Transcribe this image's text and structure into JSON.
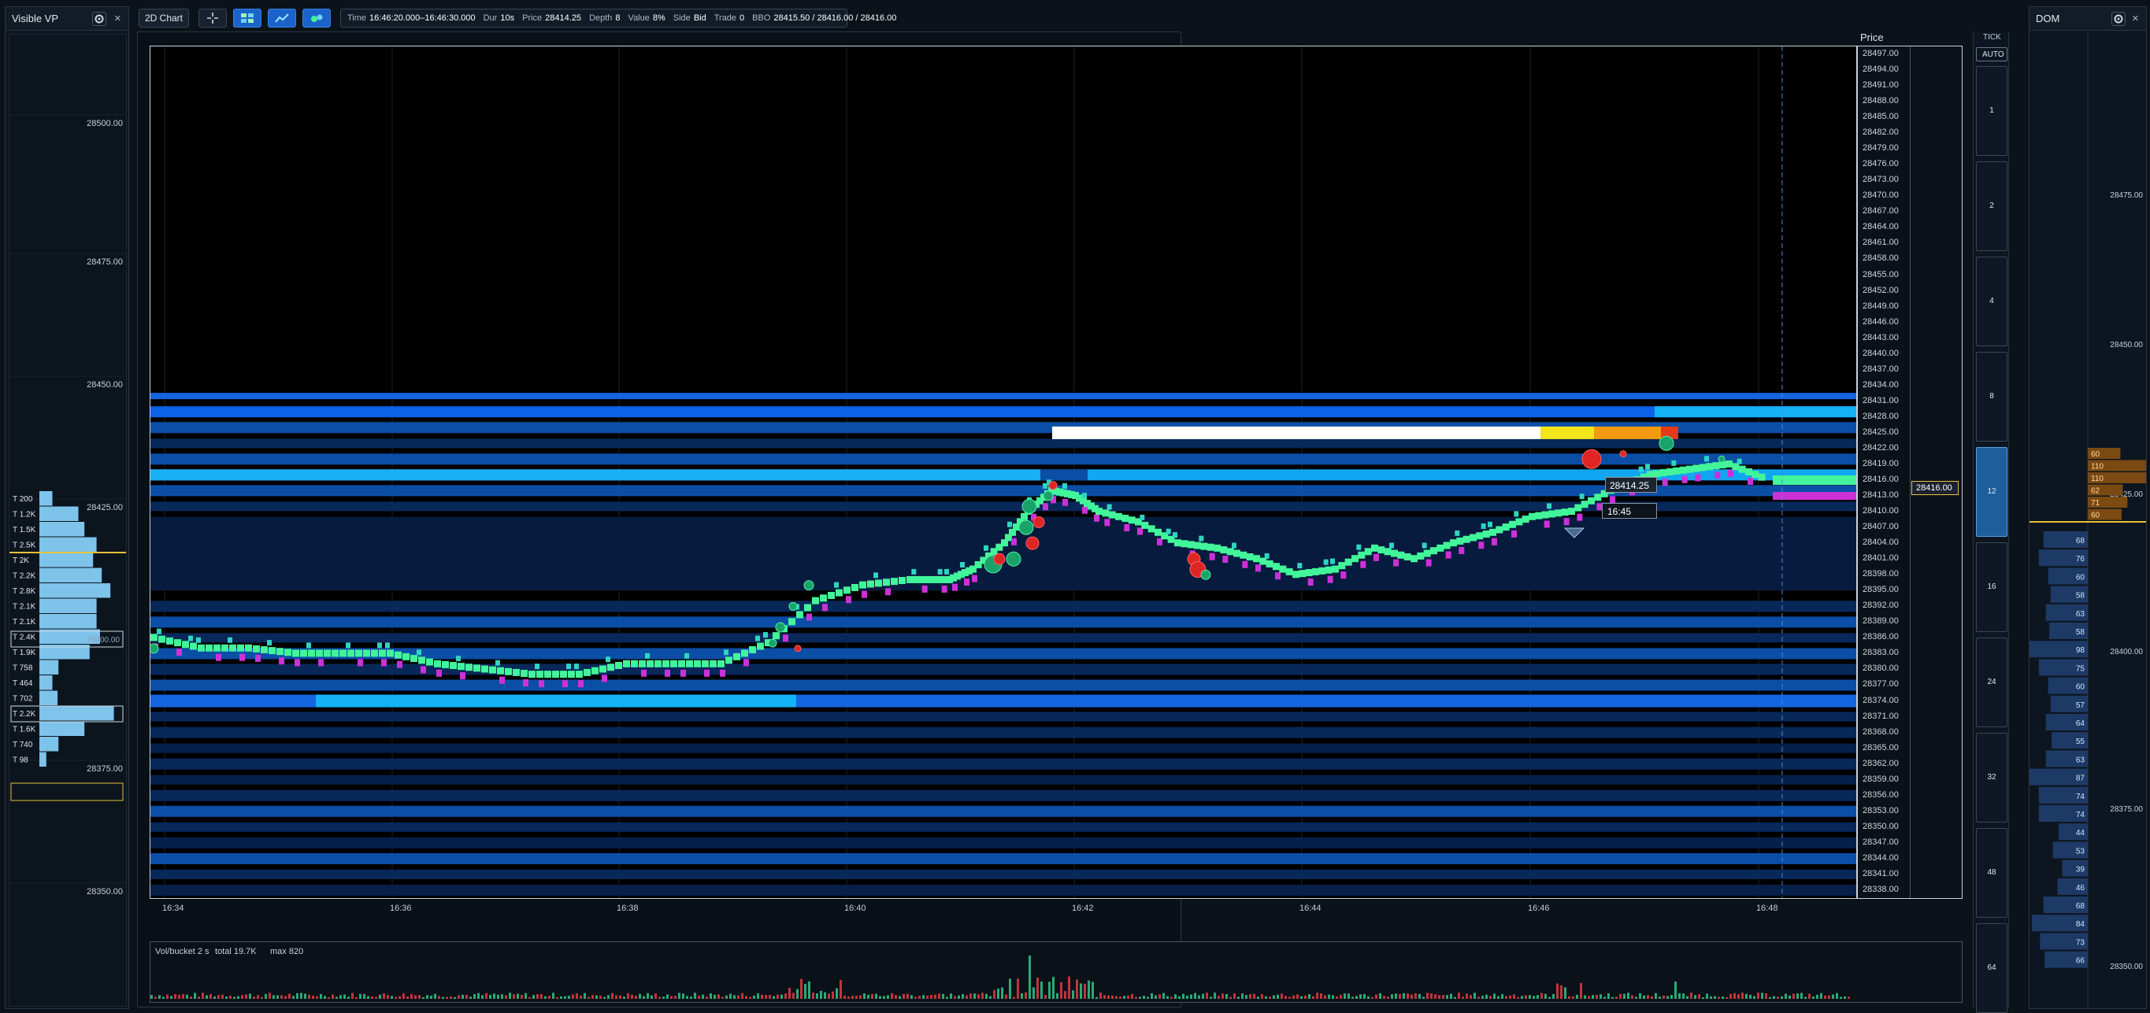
{
  "colors": {
    "bg": "#0b1219",
    "panel": "#0d1620",
    "heat_dark": "#08285a",
    "heat_mid": "#0b4ea6",
    "heat_bright": "#1565e0",
    "heat_cyan": "#11a6f2",
    "buy": "#43f59a",
    "sell": "#cc31d8",
    "buy_circle": "#19a36a",
    "sell_circle": "#e02525",
    "profile": "#7ec3ea",
    "dom_bid": "#1d3a66",
    "dom_ask": "#7a4a12",
    "highlight": "#e8c23a"
  },
  "vp": {
    "title": "Visible VP",
    "gear_icon": "gear-icon",
    "close": "×",
    "prices": [
      "28500.00",
      "28475.00",
      "28450.00",
      "28425.00",
      "28375.00",
      "28350.00"
    ],
    "rows": [
      {
        "label": "T 200",
        "v": 0.15
      },
      {
        "label": "T 1.2K",
        "v": 0.45
      },
      {
        "label": "T 1.5K",
        "v": 0.52
      },
      {
        "label": "T 2.5K",
        "v": 0.66
      },
      {
        "label": "T 2K",
        "v": 0.62
      },
      {
        "label": "T 2.2K",
        "v": 0.72
      },
      {
        "label": "T 2.8K",
        "v": 0.82
      },
      {
        "label": "T 2.1K",
        "v": 0.66
      },
      {
        "label": "T 2.1K",
        "v": 0.66
      },
      {
        "label": "T 2.4K",
        "v": 0.7
      },
      {
        "label": "T 1.9K",
        "v": 0.58
      },
      {
        "label": "T 758",
        "v": 0.22
      },
      {
        "label": "T 464",
        "v": 0.15
      },
      {
        "label": "T 702",
        "v": 0.21
      },
      {
        "label": "T 2.2K",
        "v": 0.86
      },
      {
        "label": "T 1.6K",
        "v": 0.52
      },
      {
        "label": "T 740",
        "v": 0.22
      },
      {
        "label": "T 98",
        "v": 0.08
      }
    ],
    "hidden_label": "28400.00"
  },
  "toolbar": {
    "chart_mode": "2D Chart",
    "crosshair_icon": "crosshair-icon",
    "heatmap_icon": "heatmap-icon",
    "line_icon": "line-chart-icon",
    "bubbles_icon": "bubbles-icon"
  },
  "info": {
    "time_label": "Time",
    "time": "16:46:20.000–16:46:30.000",
    "dur_label": "Dur",
    "dur": "10s",
    "price_label": "Price",
    "price": "28414.25",
    "depth_label": "Depth",
    "depth": "8",
    "value_label": "Value",
    "value": "8%",
    "side_label": "Side",
    "side": "Bid",
    "trade_label": "Trade",
    "trade": "0",
    "bbo_label": "BBO",
    "bbo": "28415.50 / 28416.00 / 28416.00"
  },
  "price_axis": {
    "title": "Price",
    "labels": [
      "28497.00",
      "28494.00",
      "28491.00",
      "28488.00",
      "28485.00",
      "28482.00",
      "28479.00",
      "28476.00",
      "28473.00",
      "28470.00",
      "28467.00",
      "28464.00",
      "28461.00",
      "28458.00",
      "28455.00",
      "28452.00",
      "28449.00",
      "28446.00",
      "28443.00",
      "28440.00",
      "28437.00",
      "28434.00",
      "28431.00",
      "28428.00",
      "28425.00",
      "28422.00",
      "28419.00",
      "28416.00",
      "28413.00",
      "28410.00",
      "28407.00",
      "28404.00",
      "28401.00",
      "28398.00",
      "28395.00",
      "28392.00",
      "28389.00",
      "28386.00",
      "28383.00",
      "28380.00",
      "28377.00",
      "28374.00",
      "28371.00",
      "28368.00",
      "28365.00",
      "28362.00",
      "28359.00",
      "28356.00",
      "28353.00",
      "28350.00",
      "28347.00",
      "28344.00",
      "28341.00",
      "28338.00"
    ],
    "current": "28416.00"
  },
  "time_axis": {
    "labels": [
      "16:34",
      "16:36",
      "16:38",
      "16:40",
      "16:42",
      "16:44",
      "16:46",
      "16:48"
    ]
  },
  "crosshair": {
    "price": "28414.25",
    "time": "16:45"
  },
  "volume": {
    "title": "Vol/bucket 2 s",
    "total": "total 19.7K",
    "max": "max 820"
  },
  "tick": {
    "title": "TICK",
    "auto": "AUTO",
    "options": [
      "1",
      "2",
      "4",
      "8",
      "12",
      "16",
      "24",
      "32",
      "48",
      "64"
    ],
    "selected": "12"
  },
  "dom": {
    "title": "DOM",
    "gear_icon": "gear-icon",
    "close": "×",
    "prices": [
      "28475.00",
      "28450.00",
      "28425.00",
      "28400.00",
      "28375.00",
      "28350.00"
    ],
    "asks": [
      {
        "size": "60",
        "v": 0.28
      },
      {
        "size": "110",
        "v": 0.55
      },
      {
        "size": "110",
        "v": 0.55
      },
      {
        "size": "62",
        "v": 0.3
      },
      {
        "size": "71",
        "v": 0.34
      },
      {
        "size": "60",
        "v": 0.29
      }
    ],
    "bids": [
      {
        "size": "68",
        "v": 0.38
      },
      {
        "size": "76",
        "v": 0.42
      },
      {
        "size": "60",
        "v": 0.34
      },
      {
        "size": "58",
        "v": 0.32
      },
      {
        "size": "63",
        "v": 0.36
      },
      {
        "size": "58",
        "v": 0.33
      },
      {
        "size": "98",
        "v": 0.56
      },
      {
        "size": "75",
        "v": 0.42
      },
      {
        "size": "60",
        "v": 0.34
      },
      {
        "size": "57",
        "v": 0.32
      },
      {
        "size": "64",
        "v": 0.36
      },
      {
        "size": "55",
        "v": 0.31
      },
      {
        "size": "63",
        "v": 0.36
      },
      {
        "size": "87",
        "v": 0.5
      },
      {
        "size": "74",
        "v": 0.42
      },
      {
        "size": "74",
        "v": 0.42
      },
      {
        "size": "44",
        "v": 0.25
      },
      {
        "size": "53",
        "v": 0.3
      },
      {
        "size": "39",
        "v": 0.22
      },
      {
        "size": "46",
        "v": 0.26
      },
      {
        "size": "68",
        "v": 0.38
      },
      {
        "size": "84",
        "v": 0.48
      },
      {
        "size": "73",
        "v": 0.41
      },
      {
        "size": "66",
        "v": 0.37
      }
    ]
  }
}
